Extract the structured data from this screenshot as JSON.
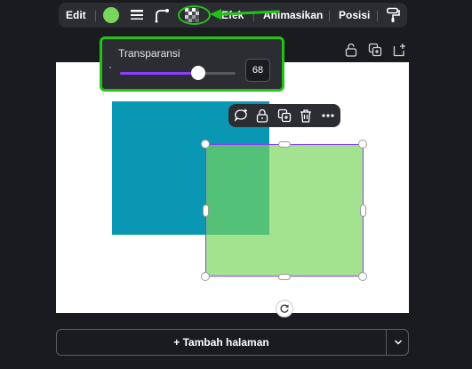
{
  "toolbar": {
    "edit_label": "Edit",
    "fill_color": "#78d65c",
    "effects_label": "Efek",
    "animate_label": "Animasikan",
    "position_label": "Posisi"
  },
  "transparency": {
    "label": "Transparansi",
    "value": "68",
    "percent": 68
  },
  "canvas": {
    "shape_blue_color": "#0a97b4",
    "shape_green_color": "#78d65c",
    "selection_color": "#8b3dff"
  },
  "footer": {
    "add_page_label": "+ Tambah halaman"
  },
  "highlight_color": "#22c414"
}
